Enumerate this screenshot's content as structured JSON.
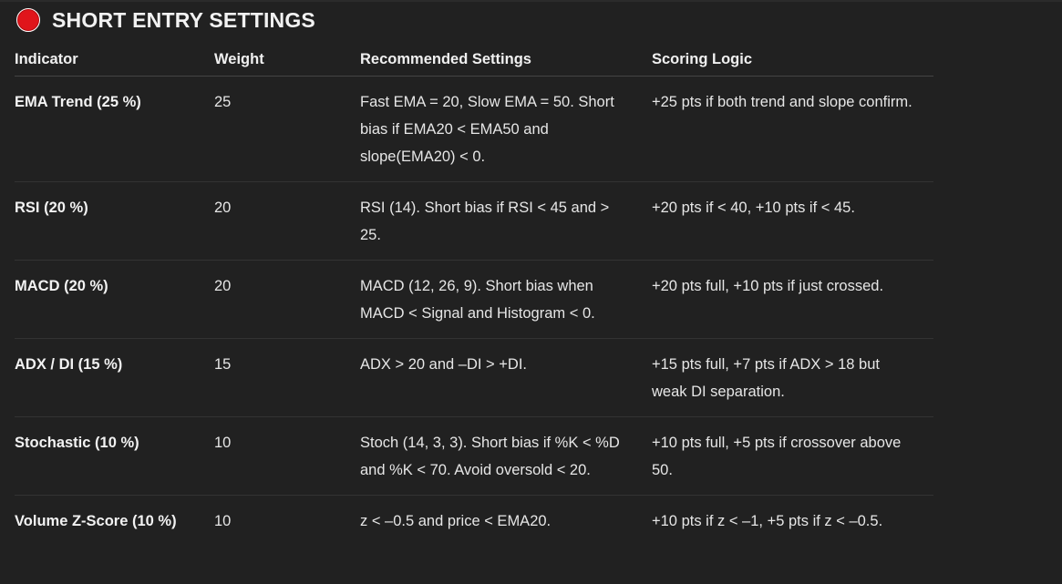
{
  "header": {
    "title": "SHORT ENTRY SETTINGS",
    "icon": "red-circle-icon",
    "icon_color": "#e0151b"
  },
  "table": {
    "columns": [
      "Indicator",
      "Weight",
      "Recommended Settings",
      "Scoring Logic"
    ],
    "rows": [
      {
        "indicator": "EMA Trend (25 %)",
        "weight": "25",
        "settings": "Fast EMA = 20, Slow EMA = 50. Short bias if EMA20 < EMA50 and slope(EMA20) < 0.",
        "logic": "+25 pts if both trend and slope confirm."
      },
      {
        "indicator": "RSI (20 %)",
        "weight": "20",
        "settings": "RSI (14). Short bias if RSI < 45 and > 25.",
        "logic": "+20 pts if < 40, +10 pts if < 45."
      },
      {
        "indicator": "MACD (20 %)",
        "weight": "20",
        "settings": "MACD (12, 26, 9). Short bias when MACD < Signal and Histogram < 0.",
        "logic": "+20 pts full, +10 pts if just crossed."
      },
      {
        "indicator": "ADX / DI (15 %)",
        "weight": "15",
        "settings": "ADX > 20 and –DI > +DI.",
        "logic": "+15 pts full, +7 pts if ADX > 18 but weak DI separation."
      },
      {
        "indicator": "Stochastic (10 %)",
        "weight": "10",
        "settings": "Stoch (14, 3, 3). Short bias if %K < %D and %K < 70. Avoid oversold < 20.",
        "logic": "+10 pts full, +5 pts if crossover above 50."
      },
      {
        "indicator": "Volume Z-Score (10 %)",
        "weight": "10",
        "settings": "z < –0.5 and price < EMA20.",
        "logic": "+10 pts if z < –1, +5 pts if z < –0.5."
      }
    ]
  }
}
